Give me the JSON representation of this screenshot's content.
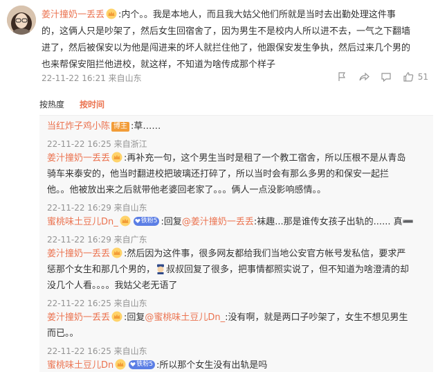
{
  "main": {
    "username": "姜汁撞奶一丢丢",
    "text_line1": ":内个。。我是本地人，而且我大姑父他们所就是当时去出勤处理这件事",
    "text_line2": "的，这俩人只是吵架了，然后女生回宿舍了，因为男生不是校内人所以进不去，一气之下翻墙",
    "text_line3": "进了，然后被保安以为他是闯进来的坏人就拦住他了，他跟保安发生争执，然后过来几个男的",
    "text_line4": "也来帮保安阻拦他进校，就这样，不知道为啥传成那个样子",
    "meta": "22-11-22 16:21 来自山东",
    "like_count": "51"
  },
  "sort": {
    "hot_label": "按热度",
    "time_label": "按时间"
  },
  "replies": [
    {
      "username": "当红炸子鸡小陈",
      "tag": "博主",
      "text": ":草……",
      "meta": "22-11-22 16:25 来自浙江"
    },
    {
      "username": "姜汁撞奶一丢丢",
      "line1": ":再补充一句，这个男生当时是租了一个教工宿舍，所以压根不是从青岛",
      "line2": "骑车来泰安的，他当时翻进校把玻璃还打碎了，所以当时会有那么多男的和保安一起拦",
      "line3": "他。。他被放出来之后就带他老婆回老家了。。。俩人一点没影响感情。。",
      "meta": "22-11-22 16:29 来自山东"
    },
    {
      "username": "蜜桃味土豆儿Dn_",
      "fan_level": "铁粉5",
      "prefix": ":回复",
      "mention": "@姜汁撞奶一丢丢",
      "text": ":袜趣...那是谁传女孩子出轨的...... 真➖",
      "meta": "22-11-22 16:29 来自广东"
    },
    {
      "username": "姜汁撞奶一丢丢",
      "line1": ":然后因为这件事，很多网友都给我们当地公安官方帐号发私信，要求严",
      "line2": "惩那个女生和那几个男的，",
      "line2b": "叔叔回复了很多，把事情都照实说了，但不知道为啥澄清的却",
      "line3": "没几个人看。。。。我姑父老无语了",
      "meta": "22-11-22 16:25 来自山东"
    },
    {
      "username": "姜汁撞奶一丢丢",
      "prefix": ":回复",
      "mention": "@蜜桃味土豆儿Dn_",
      "line1": ":没有啊，就是两口子吵架了，女生不想见男生",
      "line2": "而已。。",
      "meta": "22-11-22 16:25 来自山东"
    },
    {
      "username": "蜜桃味土豆儿Dn",
      "fan_level": "铁粉5",
      "text": ":所以那个女生没有出轨是吗"
    }
  ],
  "colors": {
    "username": "#eb7350",
    "meta": "#939393",
    "reply_bg": "#f8f8f8",
    "owner_tag": "#f29c38",
    "fan_tag": "#5b7ee5"
  }
}
